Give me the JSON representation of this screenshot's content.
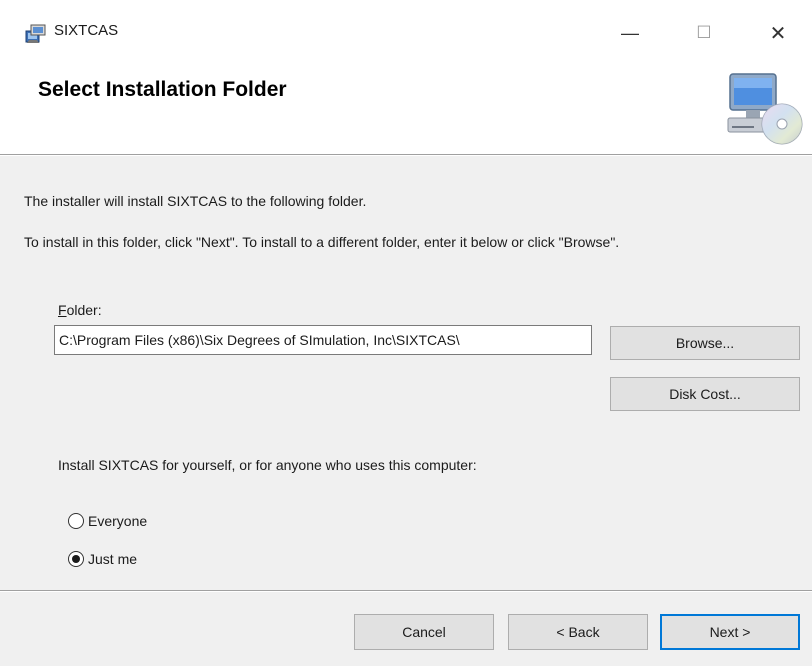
{
  "window": {
    "title": "SIXTCAS",
    "icon": "installer-icon",
    "controls": {
      "minimize": "—",
      "maximize": "☐",
      "close": "✕"
    }
  },
  "header": {
    "title": "Select Installation Folder",
    "graphic": "computer-cd-icon"
  },
  "body": {
    "intro": "The installer will install SIXTCAS to the following folder.",
    "instruction": "To install in this folder, click \"Next\". To install to a different folder, enter it below or click \"Browse\".",
    "folder_label_accel": "F",
    "folder_label_rest": "older:",
    "folder_value": "C:\\Program Files (x86)\\Six Degrees of SImulation, Inc\\SIXTCAS\\",
    "browse_label": "Browse...",
    "disk_cost_label": "Disk Cost...",
    "scope_prompt": "Install SIXTCAS for yourself, or for anyone who uses this computer:",
    "options": [
      {
        "label": "Everyone",
        "selected": false
      },
      {
        "label": "Just me",
        "selected": true
      }
    ]
  },
  "footer": {
    "cancel_label": "Cancel",
    "back_label": "< Back",
    "next_label": "Next >"
  },
  "colors": {
    "body_bg": "#f0f0f0",
    "button_bg": "#e1e1e1",
    "default_button_border": "#0078d7"
  }
}
